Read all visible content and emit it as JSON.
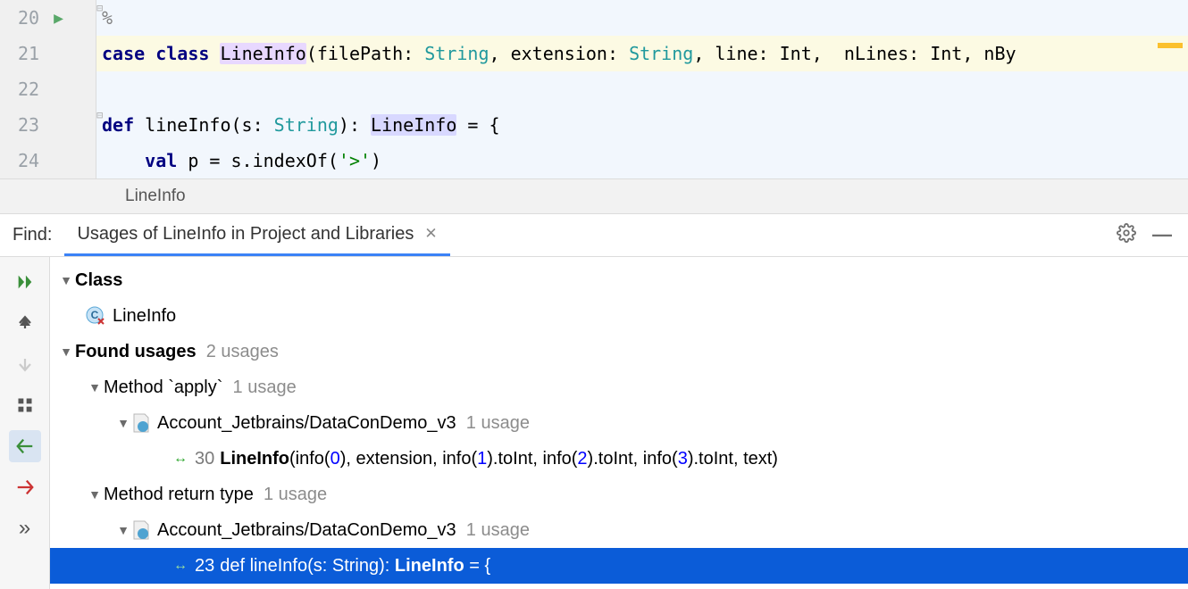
{
  "gutter": {
    "lines": [
      "20",
      "21",
      "22",
      "23",
      "24"
    ]
  },
  "editor": {
    "line20_text": "%",
    "line21": {
      "kw1": "case",
      "kw2": "class",
      "classname": "LineInfo",
      "rest": "(filePath: ",
      "t1": "String",
      "c1": ", extension: ",
      "t2": "String",
      "c2": ", line: Int,  nLines: Int, nBy"
    },
    "line23": {
      "kw": "def",
      "name": " lineInfo(s: ",
      "t1": "String",
      "paren": "): ",
      "ret": "LineInfo",
      "tail": " = {"
    },
    "line24": {
      "kw": "val",
      "rest": " p = s.indexOf(",
      "lit": "'>'",
      "close": ")"
    }
  },
  "breadcrumb": "LineInfo",
  "find": {
    "label": "Find:",
    "tab_title": "Usages of LineInfo in Project and Libraries"
  },
  "tree": {
    "class_header": "Class",
    "class_name": "LineInfo",
    "found_label": "Found usages",
    "found_count": "2 usages",
    "method_apply": "Method `apply`",
    "apply_count": "1 usage",
    "project_label": "Account_Jetbrains/DataConDemo_v3",
    "project_count": "1 usage",
    "apply_usage": {
      "lineno": "30",
      "bold": "LineInfo",
      "p0": "(info(",
      "n0": "0",
      "p1": "), extension, info(",
      "n1": "1",
      "p2": ").toInt, info(",
      "n2": "2",
      "p3": ").toInt, info(",
      "n3": "3",
      "p4": ").toInt, text)"
    },
    "method_return": "Method return type",
    "return_count": "1 usage",
    "return_usage": {
      "lineno": "23",
      "pre": "def lineInfo(s: String): ",
      "bold": "LineInfo",
      "post": " = {"
    }
  }
}
